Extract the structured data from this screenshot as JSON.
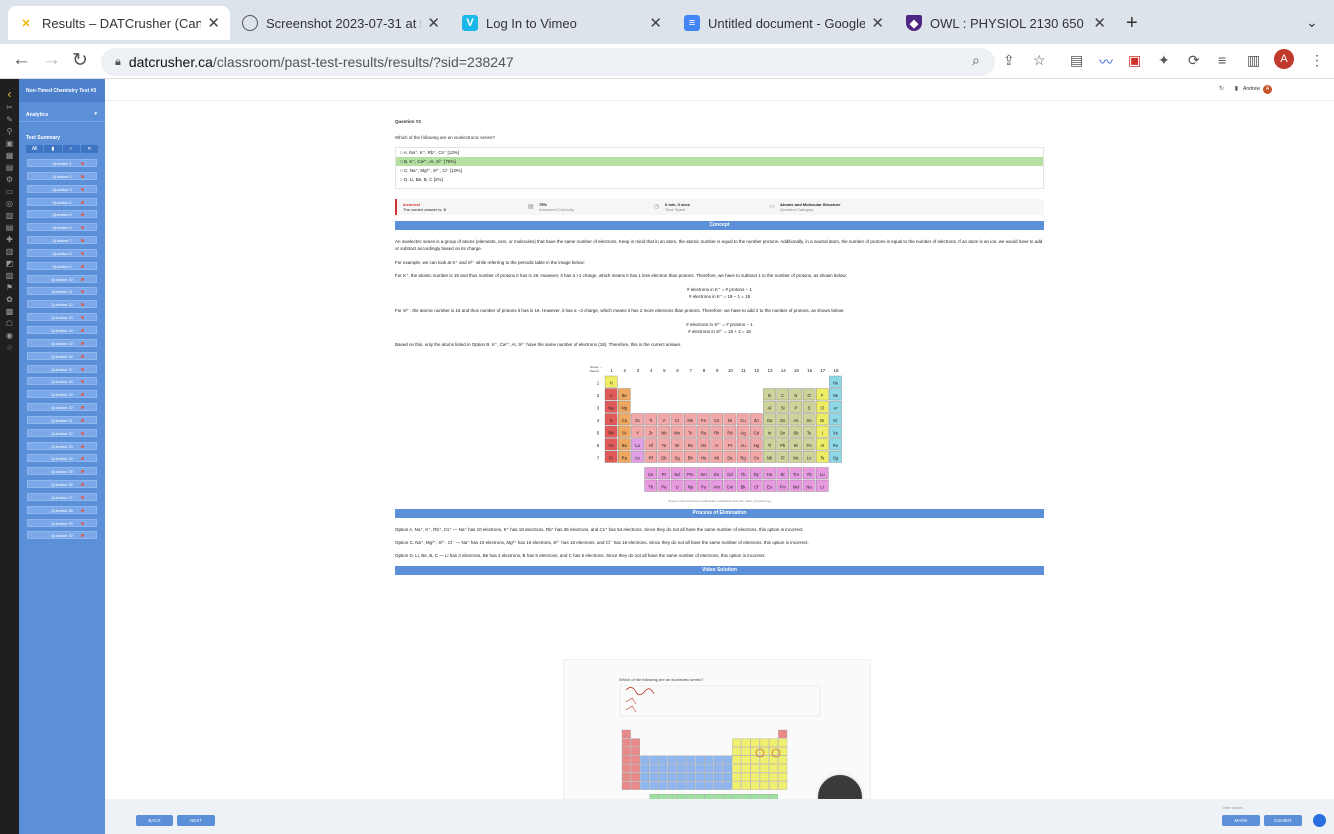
{
  "browser": {
    "tabs": [
      {
        "title": "Results – DATCrusher (Canadia",
        "icon": "x-icon",
        "color": "#f0b400"
      },
      {
        "title": "Screenshot 2023-07-31 at 5.0",
        "icon": "globe-icon",
        "color": "#555555"
      },
      {
        "title": "Log In to Vimeo",
        "icon": "vimeo-icon",
        "color": "#1ab7ea"
      },
      {
        "title": "Untitled document - Google Do",
        "icon": "docs-icon",
        "color": "#4285f4"
      },
      {
        "title": "OWL : PHYSIOL 2130 650 SU2",
        "icon": "owl-icon",
        "color": "#4f2683"
      }
    ],
    "url_domain": "datcrusher.ca",
    "url_path": "/classroom/past-test-results/results/?sid=238247",
    "profile_initial": "A"
  },
  "sidebar": {
    "title": "Non-Timed Chemistry Test #3",
    "analytics": "Analytics",
    "summary": "Test Summary",
    "tools": [
      "All",
      "▮",
      "✓",
      "✕"
    ],
    "questions": [
      "Question 1",
      "Question 2",
      "Question 3",
      "Question 4",
      "Question 5",
      "Question 6",
      "Question 7",
      "Question 8",
      "Question 9",
      "Question 10",
      "Question 11",
      "Question 12",
      "Question 13",
      "Question 14",
      "Question 15",
      "Question 16",
      "Question 17",
      "Question 18",
      "Question 19",
      "Question 20",
      "Question 21",
      "Question 22",
      "Question 23",
      "Question 24",
      "Question 25",
      "Question 26",
      "Question 27",
      "Question 28",
      "Question 29",
      "Question 30"
    ]
  },
  "header": {
    "user": "Andrew",
    "avatar": "A"
  },
  "question": {
    "number": "Question #3",
    "text": "Which of the following are an isoelectronic series?",
    "options": [
      {
        "label": "A. Na⁺, K⁺, Rb⁺, Cs⁺ [13%]",
        "correct": false
      },
      {
        "label": "B. K⁺, Ca²⁺, Ar, S²⁻ [75%]",
        "correct": true
      },
      {
        "label": "C. Na⁺, Mg²⁺, S²⁻, Cl⁻ [10%]",
        "correct": false
      },
      {
        "label": "D. Li, Be, B, C [2%]",
        "correct": false
      }
    ]
  },
  "result": {
    "status": "Incorrect",
    "correct_answer": "The correct answer is: B",
    "pct": "75%",
    "pct_label": "Answered Correctly",
    "time": "0 min, 0 secs",
    "time_label": "Time Spent",
    "category": "Atomic and Molecular Structure",
    "category_label": "Question Category"
  },
  "concept": {
    "heading": "Concept",
    "p1": "An isoelectric series is a group of atoms (elements, ions, or molecules) that have the same number of electrons. Keep in mind that in an atom, the atomic number is equal to the number protons. Additionally, in a neutral atom, the number of protons is equal to the number of electrons. If an atom is an ion, we would have to add or subtract accordingly based on its charge.",
    "p2": "For example, we can look at K⁺ and S²⁻ while referring to the periodic table in the image below:",
    "p3": "For K⁺, the atomic number is 19 and thus number of protons it has is 19. However, it has a +1 charge, which means it has 1 less electron than protons. Therefore, we have to subtract 1 to the number of protons, as shown below:",
    "eq1a": "# electrons in K⁺ = # protons − 1",
    "eq1b": "# electrons in K⁺ = 19 − 1 = 18",
    "p4": "For S²⁻, the atomic number is 16 and thus number of protons it has is 16. However, it has a −2 charge, which means it has 2 more electrons than protons. Therefore, we have to add 2 to the number of protons, as shown below:",
    "eq2a": "# electrons in S²⁻ = # protons − 1",
    "eq2b": "# electrons in S²⁻ = 16 + 2 = 18",
    "p5": "Based on this, only the atoms listed in Option B. K⁺, Ca²⁺, Ar, S²⁻ have the same number of electrons (18). Therefore, this is the correct answer.",
    "source": "Source: https://commons.wikimedia.org/wiki/File:Periodic_Table_Armtuk3.svg"
  },
  "periodic": {
    "groups": [
      "1",
      "2",
      "3",
      "4",
      "5",
      "6",
      "7",
      "8",
      "9",
      "10",
      "11",
      "12",
      "13",
      "14",
      "15",
      "16",
      "17",
      "18"
    ],
    "periods": [
      "1",
      "2",
      "3",
      "4",
      "5",
      "6",
      "7"
    ],
    "group_label": "Group →",
    "period_label": "Period",
    "rows": [
      [
        "H",
        "",
        "",
        "",
        "",
        "",
        "",
        "",
        "",
        "",
        "",
        "",
        "",
        "",
        "",
        "",
        "",
        "He"
      ],
      [
        "Li",
        "Be",
        "",
        "",
        "",
        "",
        "",
        "",
        "",
        "",
        "",
        "",
        "B",
        "C",
        "N",
        "O",
        "F",
        "Ne"
      ],
      [
        "Na",
        "Mg",
        "",
        "",
        "",
        "",
        "",
        "",
        "",
        "",
        "",
        "",
        "Al",
        "Si",
        "P",
        "S",
        "Cl",
        "Ar"
      ],
      [
        "K",
        "Ca",
        "Sc",
        "Ti",
        "V",
        "Cr",
        "Mn",
        "Fe",
        "Co",
        "Ni",
        "Cu",
        "Zn",
        "Ga",
        "Ge",
        "As",
        "Se",
        "Br",
        "Kr"
      ],
      [
        "Rb",
        "Sr",
        "Y",
        "Zr",
        "Nb",
        "Mo",
        "Tc",
        "Ru",
        "Rh",
        "Pd",
        "Ag",
        "Cd",
        "In",
        "Sn",
        "Sb",
        "Te",
        "I",
        "Xe"
      ],
      [
        "Cs",
        "Ba",
        "La",
        "Hf",
        "Ta",
        "W",
        "Re",
        "Os",
        "Ir",
        "Pt",
        "Au",
        "Hg",
        "Tl",
        "Pb",
        "Bi",
        "Po",
        "At",
        "Rn"
      ],
      [
        "Fr",
        "Ra",
        "Ac",
        "Rf",
        "Db",
        "Sg",
        "Bh",
        "Hs",
        "Mt",
        "Ds",
        "Rg",
        "Cn",
        "Nh",
        "Fl",
        "Mc",
        "Lv",
        "Ts",
        "Og"
      ]
    ],
    "lanthanides": [
      "Ce",
      "Pr",
      "Nd",
      "Pm",
      "Sm",
      "Eu",
      "Gd",
      "Tb",
      "Dy",
      "Ho",
      "Er",
      "Tm",
      "Yb",
      "Lu"
    ],
    "actinides": [
      "Th",
      "Pa",
      "U",
      "Np",
      "Pu",
      "Am",
      "Cm",
      "Bk",
      "Cf",
      "Es",
      "Fm",
      "Md",
      "No",
      "Lr"
    ]
  },
  "elimination": {
    "heading": "Process of Elimination",
    "a": "Option A. Na⁺, K⁺, Rb⁺, Cs⁺ — Na⁺ has 10 electrons, K⁺ has 18 electrons, Rb⁺ has 36 electrons, and Cs⁺ has 54 electrons. Since they do not all have the same number of electrons, this option is incorrect.",
    "c": "Option C. Na⁺, Mg²⁺, S²⁻, Cl⁻ — Na⁺ has 10 electrons, Mg²⁺ has 10 electrons, S²⁻ has 18 electrons, and Cl⁻ has 18 electrons. Since they do not all have the same number of electrons, this option is incorrect.",
    "d": "Option D. Li, Be, B, C — Li has 3 electrons, Be has 4 electrons, B has 5 electrons, and C has 6 electrons. Since they do not all have the same number of electrons, this option is incorrect."
  },
  "video": {
    "heading": "Video Solution",
    "question": "Which of the following are an isoelectric series?"
  },
  "footer": {
    "back": "BACK",
    "next": "NEXT",
    "other": "Other actions",
    "mark": "MARK",
    "exhibit": "EXHIBIT"
  }
}
